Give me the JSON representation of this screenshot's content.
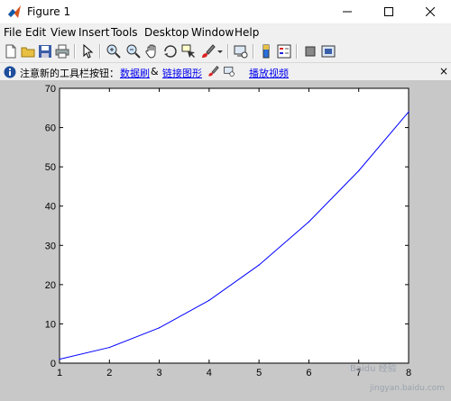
{
  "window": {
    "title": "Figure 1",
    "icon": "matlab-icon"
  },
  "window_controls": [
    "minimize-icon",
    "maximize-icon",
    "close-icon"
  ],
  "menu": [
    "File",
    "Edit",
    "View",
    "Insert",
    "Tools",
    "Desktop",
    "Window",
    "Help"
  ],
  "toolbar": [
    "new-figure-icon",
    "open-file-icon",
    "save-icon",
    "print-icon",
    "pointer-icon",
    "zoom-in-icon",
    "zoom-out-icon",
    "pan-icon",
    "rotate-3d-icon",
    "data-cursor-icon",
    "brush-icon",
    "link-plot-icon",
    "colorbar-icon",
    "legend-icon",
    "hide-plot-tools-icon",
    "show-plot-tools-icon"
  ],
  "infobar": {
    "text": "注意新的工具栏按钮：",
    "link1": "数据刷",
    "amp": "&",
    "link2": "链接图形",
    "link3": "播放视频",
    "close": "×"
  },
  "watermark": {
    "line1": "Baidu 经验",
    "line2": "jingyan.baidu.com"
  },
  "chart_data": {
    "type": "line",
    "x": [
      1,
      2,
      3,
      4,
      5,
      6,
      7,
      8
    ],
    "series": [
      {
        "values": [
          1,
          4,
          9,
          16,
          25,
          36,
          49,
          64
        ],
        "color": "#0000ff"
      }
    ],
    "xlim": [
      1,
      8
    ],
    "ylim": [
      0,
      70
    ],
    "xticks": [
      1,
      2,
      3,
      4,
      5,
      6,
      7,
      8
    ],
    "yticks": [
      0,
      10,
      20,
      30,
      40,
      50,
      60,
      70
    ],
    "title": "",
    "xlabel": "",
    "ylabel": "",
    "grid": false,
    "background": "#c8c8c8"
  }
}
